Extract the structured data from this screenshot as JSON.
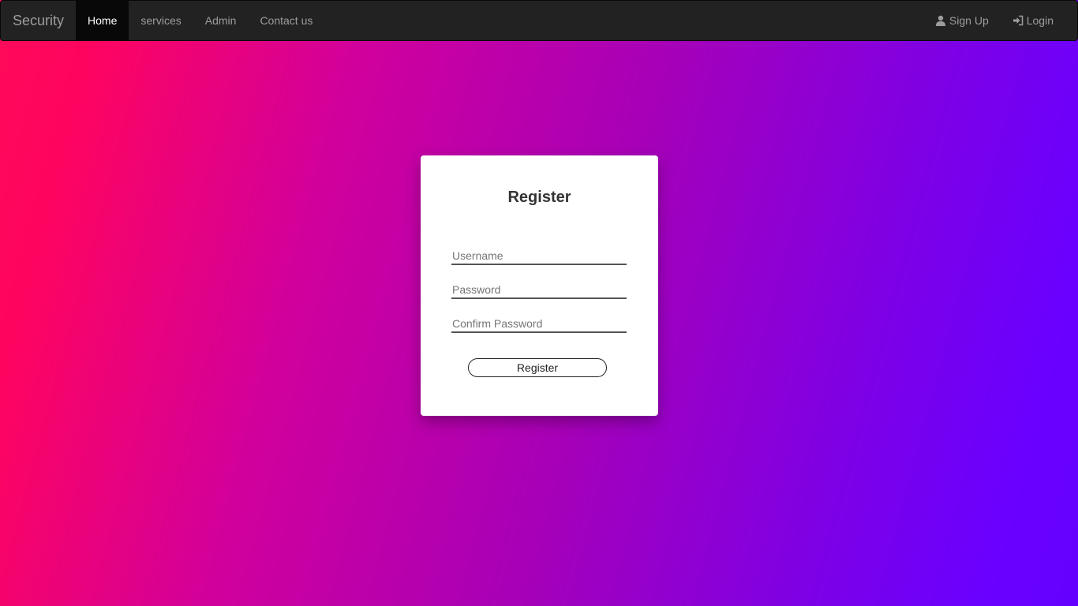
{
  "navbar": {
    "brand": "Security",
    "left_items": [
      {
        "label": "Home",
        "active": true
      },
      {
        "label": "services",
        "active": false
      },
      {
        "label": "Admin",
        "active": false
      },
      {
        "label": "Contact us",
        "active": false
      }
    ],
    "right_items": [
      {
        "label": "Sign Up",
        "icon": "user-icon"
      },
      {
        "label": "Login",
        "icon": "login-icon"
      }
    ]
  },
  "register_form": {
    "heading": "Register",
    "username_placeholder": "Username",
    "password_placeholder": "Password",
    "confirm_password_placeholder": "Confirm Password",
    "submit_label": "Register"
  },
  "colors": {
    "navbar_bg": "#222222",
    "gradient_start": "#ff0a5a",
    "gradient_end": "#6400ff"
  }
}
